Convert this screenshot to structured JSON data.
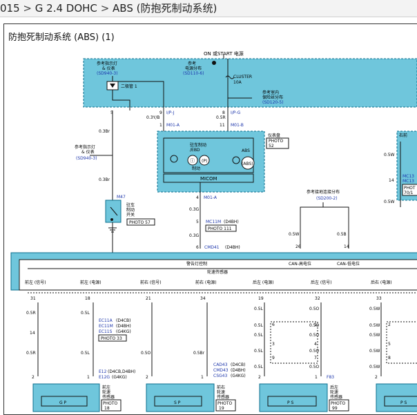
{
  "breadcrumb": {
    "items": [
      "015",
      "G 2.4 DOHC",
      "ABS",
      "(防抱死制动系统)"
    ],
    "sep": ">"
  },
  "title": "防抱死制动系统 (ABS) (1)",
  "colors": {
    "box_fill": "#6fc6dc",
    "box_border": "#0a6e8c",
    "wire": "#111",
    "ref_blue": "#1a33aa"
  },
  "top_power": {
    "label": "ON 或START 电源",
    "ref1_l1": "参考指示灯",
    "ref1_l2": "& 仪表",
    "ref1_code": "(SD940-3)",
    "ref2_l1": "参考",
    "ref2_l2": "电源分布",
    "ref2_code": "(SD110-6)",
    "diode": "二极管 1",
    "fuse": "CLUSTER",
    "fuse_a": "10A",
    "ref3_l1": "参考室内",
    "ref3_l2": "保险丝分布",
    "ref3_code": "(SD120-5)"
  },
  "cluster": {
    "pin5": "5",
    "pin9": "9",
    "pin8": "8",
    "ipj": "I/P-J",
    "ipg": "I/P-G",
    "w1": "0.3Br",
    "w2": "0.3Y/B",
    "w3": "0.5R",
    "p1": "1",
    "p11": "11",
    "m01a": "M01-A",
    "m01b": "M01-B",
    "name": "仪表盘",
    "photo": "PHOTO",
    "photo_no": "52",
    "park_l1": "驻车制动",
    "park_l2": "/EBD",
    "brake": "制动",
    "abs": "ABS",
    "abs_in": "(ABS)",
    "micom": "MICOM",
    "pin4": "4",
    "m01a2": "M01-A"
  },
  "left": {
    "w1": "0.3Br",
    "ref_l1": "参考指示灯",
    "ref_l2": "& 仪表",
    "ref_code": "(SD940-3)",
    "w2": "0.3Br",
    "m47": "M47",
    "sw_l1": "驻车",
    "sw_l2": "制动",
    "sw_l3": "开关",
    "photo": "PHOTO 57"
  },
  "mid": {
    "w1": "0.3G",
    "w2": "0.3G",
    "pin5": "5",
    "mc11m": "MC11M",
    "mc11m_s": "(D4BH)",
    "photo": "PHOTO 111",
    "pin6": "6",
    "cmd41": "CMD41",
    "cmd41_s": "(D4BH)"
  },
  "can": {
    "ref_l1": "参考接地连接分布",
    "ref_code": "(SD200-2)",
    "w1": "0.5W",
    "w2": "0.5B",
    "pin26": "26",
    "pin14": "14"
  },
  "right": {
    "label": "右前",
    "w1": "0.5W",
    "pin14": "14",
    "mc13a": "MC13",
    "mc13b": "MC13",
    "photo": "PHOT",
    "photo_no": "70/1",
    "w2": "0.5W"
  },
  "module": {
    "warn": "警告灯控制",
    "speed": "轮速传感器",
    "canh": "CAN-高电位",
    "canl": "CAN-低电位",
    "labels": [
      "前左 (信号)",
      "前左 (电源)",
      "前右 (信号)",
      "前右 (电源)",
      "后左 (电源)",
      "后左 (信号)",
      "后右 (电源)"
    ],
    "pins": [
      "31",
      "18",
      "21",
      "34",
      "19",
      "32",
      "33"
    ]
  },
  "col1": {
    "w1": "0.5R",
    "w2": "0.5L",
    "pin14": "14",
    "ec11a": "EC11A",
    "ec11a_s": "(D4CB)",
    "ec11m": "EC11M",
    "ec11m_s": "(D4BH)",
    "ec11s": "EC11S",
    "ec11s_s": "(G4KG)",
    "photo33": "PHOTO 33",
    "w3": "0.5R",
    "w4": "0.5L",
    "pin2": "2",
    "pin1": "1",
    "e12": "E12",
    "e12_s": "(D4CB,D4BH)",
    "e12g": "E12G",
    "e12g_s": "(G4KG)",
    "sensor": "G P",
    "cap_l1": "前左",
    "cap_l2": "轮速",
    "cap_l3": "传感器",
    "photo": "PHOTO",
    "photo_no": "18"
  },
  "col2": {
    "w1": "0.5O",
    "w2": "0.5Br",
    "cad43": "CAD43",
    "cad43_s": "(D4CB)",
    "cmd43": "CMD43",
    "cmd43_s": "(D4BH)",
    "csg43": "CSG43",
    "csg43_s": "(G4KG)",
    "pin2": "2",
    "pin1": "1",
    "sensor": "S P",
    "cap_l1": "前右",
    "cap_l2": "轮速",
    "cap_l3": "传感器",
    "photo": "PHOTO",
    "photo_no": "19"
  },
  "col3": {
    "w1": "0.5L",
    "w2": "0.5L",
    "w3": "0.5L",
    "w4": "0.5L",
    "w5": "0.5L",
    "p6": "6",
    "p3": "3",
    "p9": "9",
    "pin2": "2",
    "pin1": "1",
    "f83": "F83",
    "sensor": "P S",
    "cap_l1": "后左",
    "cap_l2": "轮速",
    "cap_l3": "传感器",
    "photo": "PHOTO",
    "photo_no": "99"
  },
  "col4": {
    "w1": "0.5O",
    "w2": "0.5O",
    "w3": "0.5O",
    "w4": "0.5O",
    "w5": "0.5O",
    "p1": "1",
    "p4": "4",
    "p5": "5",
    "p7": "7"
  },
  "col5": {
    "w1": "0.5W",
    "w2": "0.5W",
    "w3": "0.5W",
    "w4": "0.5W",
    "w5": "0.5W",
    "p2": "2",
    "p5": "5",
    "p8": "8",
    "pin2": "2",
    "sensor": "P S"
  }
}
